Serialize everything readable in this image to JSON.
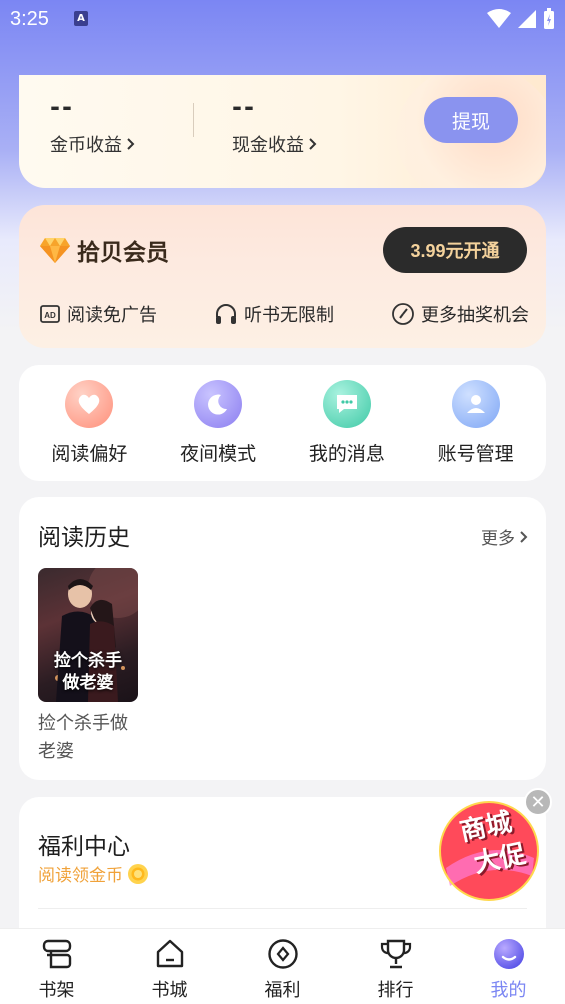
{
  "status_bar": {
    "time": "3:25",
    "notif_icon": "A"
  },
  "earnings": {
    "coins": {
      "value": "--",
      "label": "金币收益"
    },
    "cash": {
      "value": "--",
      "label": "现金收益"
    },
    "withdraw_label": "提现"
  },
  "vip": {
    "title": "拾贝会员",
    "button_label": "3.99元开通",
    "perks": [
      {
        "label": "阅读免广告",
        "icon": "ad-free-icon"
      },
      {
        "label": "听书无限制",
        "icon": "headphones-icon"
      },
      {
        "label": "更多抽奖机会",
        "icon": "clock-icon"
      }
    ]
  },
  "tools": [
    {
      "label": "阅读偏好",
      "icon": "heart-icon"
    },
    {
      "label": "夜间模式",
      "icon": "moon-icon"
    },
    {
      "label": "我的消息",
      "icon": "message-icon"
    },
    {
      "label": "账号管理",
      "icon": "user-icon"
    }
  ],
  "history": {
    "title": "阅读历史",
    "more_label": "更多",
    "books": [
      {
        "name": "捡个杀手做老婆",
        "cover_title_line1": "捡个杀手",
        "cover_title_line2": "做老婆"
      }
    ]
  },
  "welfare": {
    "title": "福利中心",
    "subtitle": "阅读领金币"
  },
  "promo": {
    "line1": "商城",
    "line2": "大促"
  },
  "tabs": [
    {
      "label": "书架",
      "icon": "bookshelf-icon"
    },
    {
      "label": "书城",
      "icon": "bookstore-icon"
    },
    {
      "label": "福利",
      "icon": "welfare-icon"
    },
    {
      "label": "排行",
      "icon": "trophy-icon"
    },
    {
      "label": "我的",
      "icon": "profile-icon",
      "active": true
    }
  ],
  "colors": {
    "accent": "#7b86f3",
    "vip_gold": "#f4d29c",
    "coin_orange": "#f0a23a"
  }
}
